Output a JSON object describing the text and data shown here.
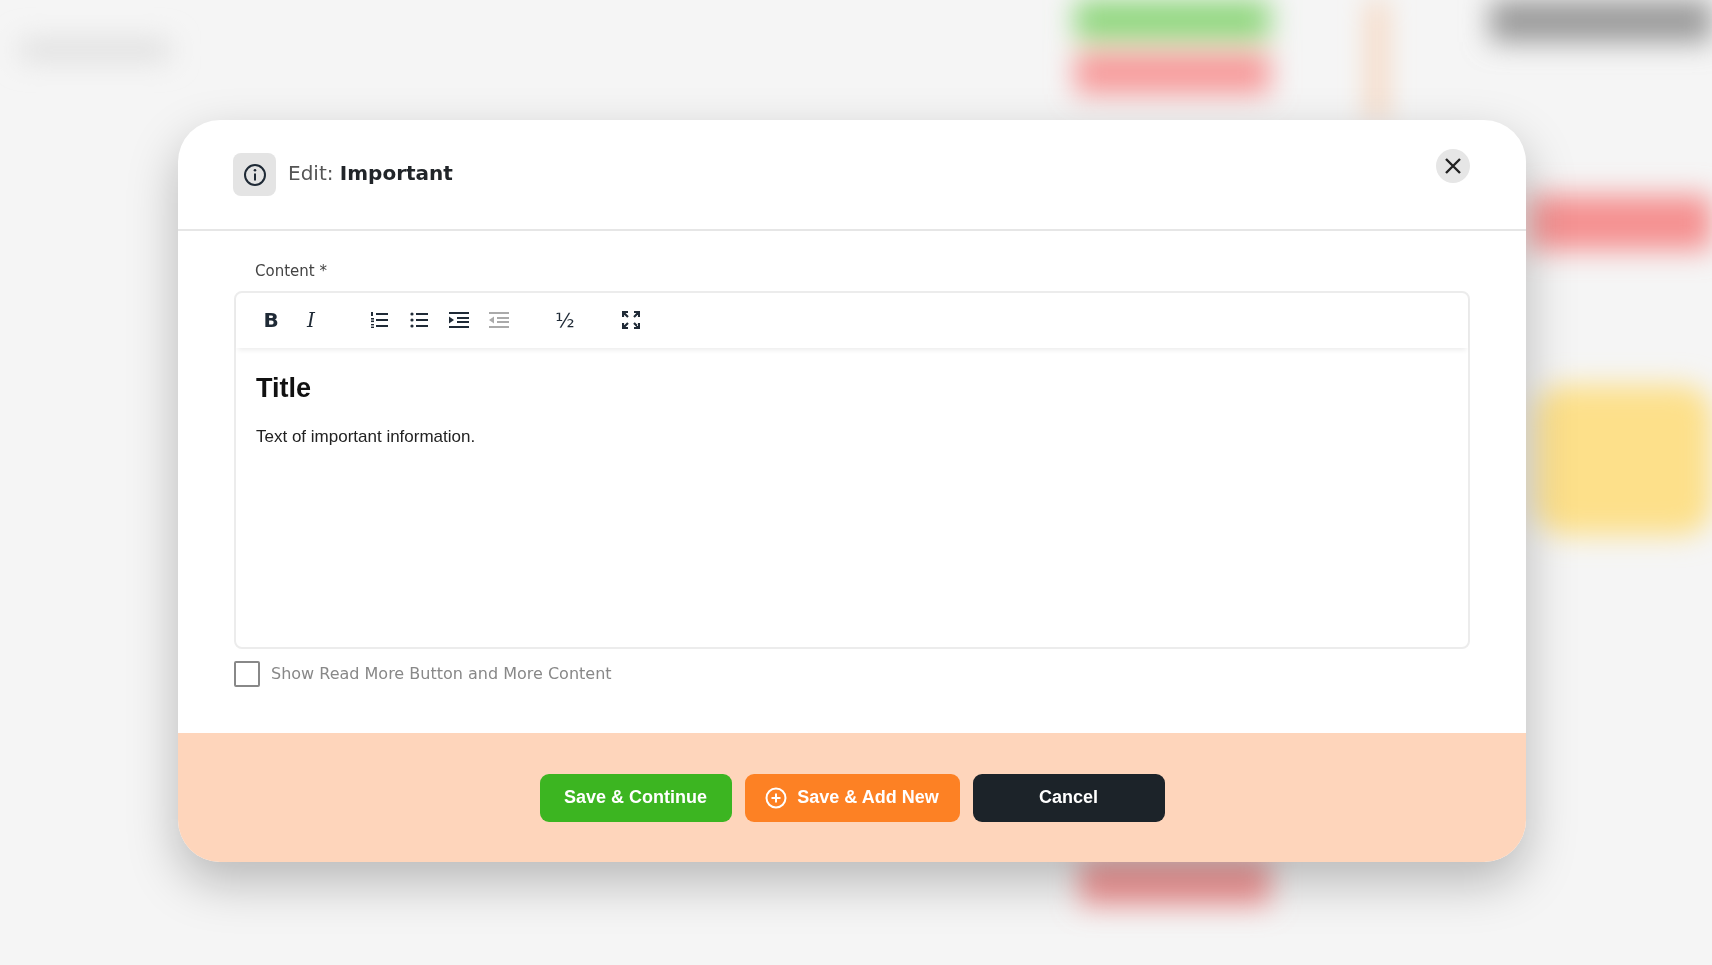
{
  "dialog": {
    "title_prefix": "Edit:",
    "title": "Important"
  },
  "field": {
    "label": "Content *"
  },
  "toolbar": [
    {
      "kind": "bold",
      "label": "B",
      "disabled": false
    },
    {
      "kind": "italic",
      "label": "I",
      "disabled": false
    },
    {
      "kind": "ordered-list",
      "disabled": false
    },
    {
      "kind": "bullet-list",
      "disabled": false
    },
    {
      "kind": "indent",
      "disabled": false
    },
    {
      "kind": "outdent",
      "disabled": true
    },
    {
      "kind": "fraction",
      "label": "½",
      "disabled": false
    },
    {
      "kind": "fullscreen",
      "disabled": false
    }
  ],
  "editor": {
    "heading": "Title",
    "paragraph": "Text of important information."
  },
  "checkbox": {
    "label": "Show Read More Button and More Content",
    "checked": false
  },
  "buttons": [
    {
      "kind": "success",
      "label": "Save & Continue"
    },
    {
      "kind": "add",
      "label": "Save & Add New"
    },
    {
      "kind": "cancel",
      "label": "Cancel"
    }
  ]
}
